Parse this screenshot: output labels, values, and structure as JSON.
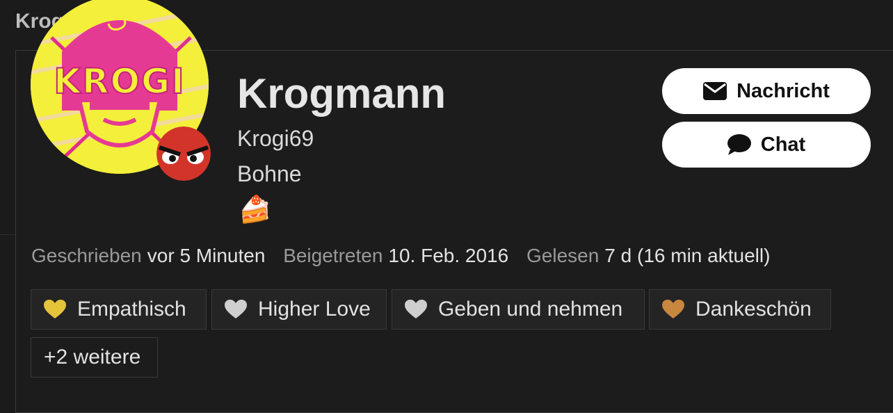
{
  "header": {
    "title": "Krogmann",
    "emoji": "🍰"
  },
  "profile": {
    "name": "Krogmann",
    "username": "Krogi69",
    "title": "Bohne",
    "status_emoji": "🍰",
    "avatar_text": "KROGI"
  },
  "actions": {
    "message_label": "Nachricht",
    "chat_label": "Chat"
  },
  "stats": [
    {
      "label": "Geschrieben",
      "value": "vor 5 Minuten"
    },
    {
      "label": "Beigetreten",
      "value": "10. Feb. 2016"
    },
    {
      "label": "Gelesen",
      "value": "7 d (16 min aktuell)"
    }
  ],
  "badges": [
    {
      "label": "Empathisch",
      "color": "#e5c33b"
    },
    {
      "label": "Higher Love",
      "color": "#cfcfcf"
    },
    {
      "label": "Geben und nehmen",
      "color": "#cfcfcf"
    },
    {
      "label": "Dankeschön",
      "color": "#c8863e"
    }
  ],
  "more_badges_label": "+2 weitere"
}
